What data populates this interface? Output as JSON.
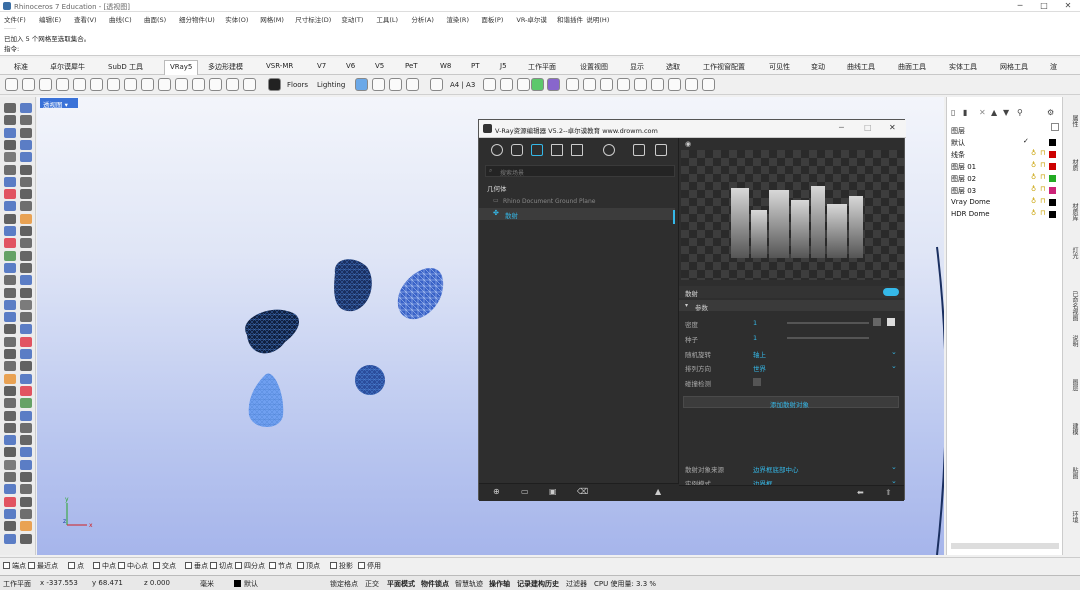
{
  "window": {
    "title": "Rhinoceros 7 Education - [透视图]"
  },
  "menu": [
    "文件(F)",
    "编辑(E)",
    "查看(V)",
    "曲线(C)",
    "曲面(S)",
    "细分物件(U)",
    "实体(O)",
    "网格(M)",
    "尺寸标注(D)",
    "变动(T)",
    "工具(L)",
    "分析(A)",
    "渲染(R)",
    "面板(P)",
    "VR-卓尔谟",
    "和谐插件",
    "说明(H)"
  ],
  "command": {
    "line1": "已加入 5 个网格至选取集合。",
    "line2": "指令:"
  },
  "tabs": [
    "标准",
    "卓尔谟犀牛",
    "SubD 工具",
    "VRay5",
    "多边形建模",
    "VSR-MR",
    "V7",
    "V6",
    "V5",
    "PeT",
    "W8",
    "PT",
    "J5",
    "工作平面",
    "设置视图",
    "显示",
    "选取",
    "工作视窗配置",
    "可见性",
    "变动",
    "曲线工具",
    "曲面工具",
    "实体工具",
    "网格工具",
    "渲"
  ],
  "toolbar": {
    "floors": "Floors",
    "lighting": "Lighting",
    "paper": "A4 | A3"
  },
  "viewport": {
    "label": "透视图",
    "axis_x": "x",
    "axis_y": "y",
    "axis_z": "z"
  },
  "vray": {
    "title": "V-Ray资源编辑器 V5.2--卓尔谟教育 www.drowm.com",
    "search_placeholder": "搜索场景",
    "section": "几何体",
    "items": [
      "Rhino Document Ground Plane",
      "散射"
    ],
    "selected_name": "散射",
    "group": "参数",
    "params": [
      {
        "label": "密度",
        "value": "1"
      },
      {
        "label": "种子",
        "value": "1"
      },
      {
        "label": "随机旋转",
        "value": "轴上"
      },
      {
        "label": "排列方向",
        "value": "世界"
      },
      {
        "label": "碰撞检测",
        "value": ""
      }
    ],
    "add_button": "添加散射对象",
    "bottom_params": [
      {
        "label": "散射对象来源",
        "value": "边界框底部中心"
      },
      {
        "label": "实例模式",
        "value": "边界框"
      }
    ]
  },
  "layers": {
    "header": "图层",
    "rows": [
      {
        "name": "默认",
        "color": "#000000"
      },
      {
        "name": "线条",
        "color": "#cc0000"
      },
      {
        "name": "图层 01",
        "color": "#cc0000"
      },
      {
        "name": "图层 02",
        "color": "#22aa22"
      },
      {
        "name": "图层 03",
        "color": "#cc2277"
      },
      {
        "name": "Vray Dome",
        "color": "#000000"
      },
      {
        "name": "HDR Dome",
        "color": "#000000"
      }
    ]
  },
  "right_tabs": [
    "属性",
    "材质",
    "材质库",
    "灯光",
    "已命名视图",
    "说明",
    "图层",
    "建模",
    "贴图",
    "环境"
  ],
  "snaps": [
    "端点",
    "最近点",
    "点",
    "中点",
    "中心点",
    "交点",
    "垂点",
    "切点",
    "四分点",
    "节点",
    "顶点",
    "投影",
    "停用"
  ],
  "status": {
    "plane": "工作平面",
    "x": "x -337.553",
    "y": "y 68.471",
    "z": "z 0.000",
    "unit": "毫米",
    "layer": "默认",
    "items": [
      "锁定格点",
      "正交",
      "平面模式",
      "物件锁点",
      "智慧轨迹",
      "操作轴",
      "记录建构历史",
      "过滤器"
    ],
    "cpu": "CPU 使用量: 3.3 %"
  }
}
